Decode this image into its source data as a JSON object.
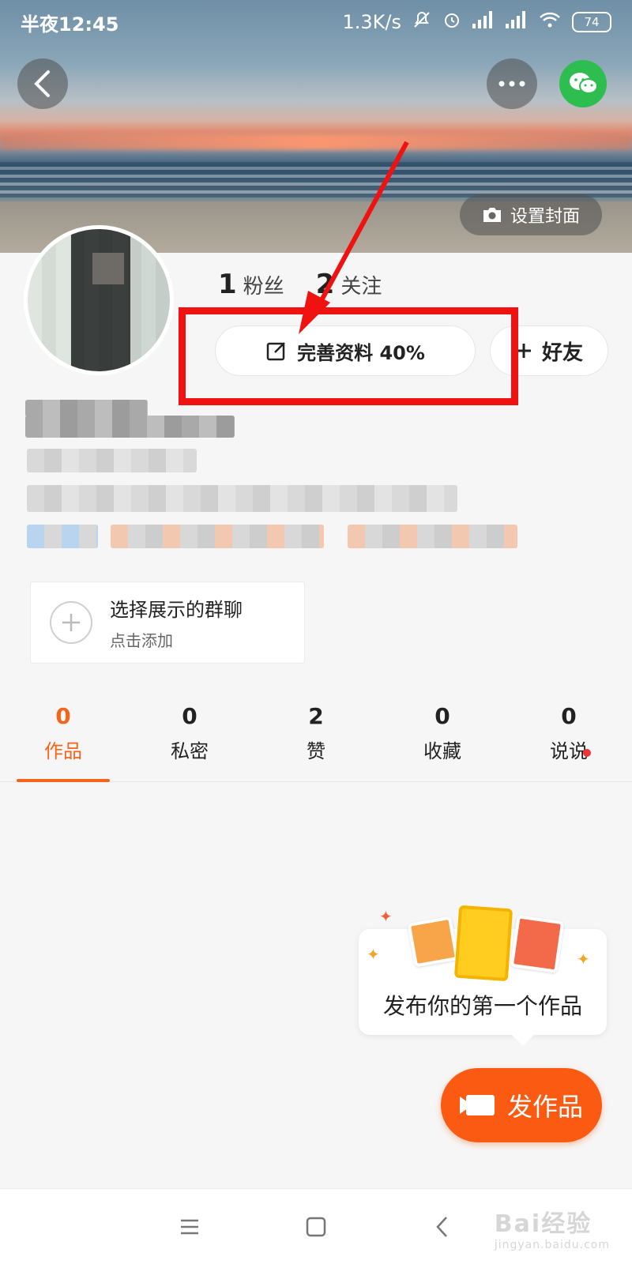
{
  "status_bar": {
    "time": "半夜12:45",
    "network_speed": "1.3K/s",
    "battery": "74",
    "icons": [
      "mute-icon",
      "alarm-icon",
      "signal-icon",
      "signal-hd-icon",
      "wifi-icon",
      "battery-icon"
    ]
  },
  "header": {
    "back_icon": "back-icon",
    "more_icon": "more-icon",
    "share_icon": "wechat-icon",
    "cover_button_label": "设置封面"
  },
  "profile": {
    "stats": [
      {
        "num": "1",
        "label": "粉丝"
      },
      {
        "num": "2",
        "label": "关注"
      }
    ],
    "edit_label": "完善资料 40%",
    "friend_label": "好友"
  },
  "group_card": {
    "title": "选择展示的群聊",
    "subtitle": "点击添加"
  },
  "tabs": [
    {
      "num": "0",
      "label": "作品",
      "active": true
    },
    {
      "num": "0",
      "label": "私密"
    },
    {
      "num": "2",
      "label": "赞"
    },
    {
      "num": "0",
      "label": "收藏"
    },
    {
      "num": "0",
      "label": "说说",
      "dot": true
    }
  ],
  "promo": {
    "text": "发布你的第一个作品"
  },
  "publish_button": "发作品",
  "watermark": {
    "brand": "Bai经验",
    "url": "jingyan.baidu.com"
  },
  "colors": {
    "accent": "#fa5a12",
    "active_tab": "#f5641b",
    "highlight": "#f01111",
    "wechat": "#2dbe4f"
  }
}
